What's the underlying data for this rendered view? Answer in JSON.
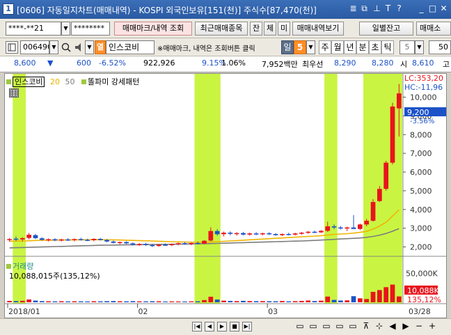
{
  "window": {
    "number": "1",
    "title": "[0606] 자동일지차트(매매내역) - KOSPI 외국인보유[151(천)] 주식수[87,470(천)] ",
    "icons": [
      "window-list-icon",
      "restore-icon",
      "help-pin-icon",
      "text-size-icon",
      "question-icon",
      "minimize-icon",
      "maximize-icon",
      "close-icon"
    ],
    "icon_glyphs": [
      "≣",
      "⧉",
      "⊥",
      "T",
      "?",
      "_",
      "□",
      "✕"
    ]
  },
  "toolbar1": {
    "account": "****-**21",
    "password": "********",
    "trade_mark_button": "매매마크/내역 조회",
    "recent_trades_button": "최근매매종목",
    "jan": "잔",
    "che": "체",
    "mi": "미",
    "trade_history_button": "매매내역보기",
    "daily_balance_button": "일별잔고",
    "trade_more_button": "매매소"
  },
  "toolbar2": {
    "code": "006490",
    "market_tag": "열",
    "stock_name": "인스코비",
    "notice": "※매매마크, 내역은 조회버튼 클릭",
    "period_label": "일",
    "period_value": "5",
    "periods": [
      "주",
      "월",
      "년",
      "분",
      "초",
      "틱"
    ],
    "tick_value": "5",
    "right_value": "50"
  },
  "quote": {
    "price": "8,600",
    "arrow": "▼",
    "change": "600",
    "change_pct": "-6.52%",
    "volume": "922,926",
    "vol_ratio": "9.15%",
    "turnover": "1.06%",
    "amount": "7,952백만",
    "best_label": "최우선",
    "best_ask": "8,290",
    "best_bid": "8,280",
    "open_label": "시",
    "open": "8,610",
    "high_label": "고"
  },
  "chart": {
    "legend_name": "인스코비",
    "ma_short": "20",
    "ma_long": "50",
    "pattern_label": "똘파미 강세패턴",
    "lc_label": "LC:353,20",
    "hc_label": "HC:-11,96",
    "price_badge": "9,200",
    "price_badge_pct": "-3.56%",
    "price_ticks": [
      "10,000",
      "9,000",
      "8,000",
      "7,000",
      "6,000",
      "5,000",
      "4,000",
      "3,000",
      "2,000"
    ],
    "volume_title": "거래량",
    "volume_value": "10,088,015주(135,12%)",
    "volume_tick": "50,000K",
    "volume_badge": "10,088K",
    "volume_badge_pct": "135,12%",
    "x_labels": [
      "2018/01",
      "02",
      "03"
    ],
    "x_right_label": "03/28",
    "colors": {
      "up": "#e8141c",
      "down": "#1c52c8",
      "highlight": "#c9f542",
      "ma20": "#f0b400",
      "ma50": "#7d7d7d"
    }
  },
  "chart_data": {
    "type": "candlestick",
    "ylim": [
      1500,
      10800
    ],
    "volume_ylim": [
      0,
      60000
    ],
    "highlight_ranges": [
      [
        1,
        2
      ],
      [
        29,
        32
      ],
      [
        49,
        50
      ],
      [
        55,
        60
      ]
    ],
    "candles": [
      {
        "o": 2380,
        "h": 2480,
        "l": 2280,
        "c": 2420,
        "v": 2400
      },
      {
        "o": 2440,
        "h": 2560,
        "l": 2320,
        "c": 2400,
        "v": 2100
      },
      {
        "o": 2400,
        "h": 2520,
        "l": 2300,
        "c": 2470,
        "v": 2600
      },
      {
        "o": 2480,
        "h": 2750,
        "l": 2400,
        "c": 2650,
        "v": 4800
      },
      {
        "o": 2630,
        "h": 2700,
        "l": 2420,
        "c": 2470,
        "v": 2900
      },
      {
        "o": 2460,
        "h": 2520,
        "l": 2330,
        "c": 2380,
        "v": 2000
      },
      {
        "o": 2380,
        "h": 2460,
        "l": 2290,
        "c": 2410,
        "v": 1700
      },
      {
        "o": 2410,
        "h": 2470,
        "l": 2310,
        "c": 2350,
        "v": 1500
      },
      {
        "o": 2340,
        "h": 2440,
        "l": 2290,
        "c": 2400,
        "v": 1800
      },
      {
        "o": 2400,
        "h": 2470,
        "l": 2320,
        "c": 2370,
        "v": 1500
      },
      {
        "o": 2370,
        "h": 2450,
        "l": 2300,
        "c": 2420,
        "v": 1700
      },
      {
        "o": 2420,
        "h": 2490,
        "l": 2340,
        "c": 2380,
        "v": 1600
      },
      {
        "o": 2380,
        "h": 2440,
        "l": 2310,
        "c": 2360,
        "v": 1400
      },
      {
        "o": 2360,
        "h": 2460,
        "l": 2300,
        "c": 2430,
        "v": 1800
      },
      {
        "o": 2430,
        "h": 2480,
        "l": 2340,
        "c": 2370,
        "v": 1600
      },
      {
        "o": 2370,
        "h": 2420,
        "l": 2250,
        "c": 2290,
        "v": 1900
      },
      {
        "o": 2290,
        "h": 2340,
        "l": 2180,
        "c": 2220,
        "v": 2100
      },
      {
        "o": 2220,
        "h": 2290,
        "l": 2140,
        "c": 2260,
        "v": 1700
      },
      {
        "o": 2260,
        "h": 2310,
        "l": 2150,
        "c": 2190,
        "v": 1600
      },
      {
        "o": 2190,
        "h": 2240,
        "l": 2080,
        "c": 2120,
        "v": 1900
      },
      {
        "o": 2120,
        "h": 2200,
        "l": 2050,
        "c": 2160,
        "v": 1600
      },
      {
        "o": 2160,
        "h": 2220,
        "l": 2060,
        "c": 2100,
        "v": 1500
      },
      {
        "o": 2100,
        "h": 2160,
        "l": 2000,
        "c": 2050,
        "v": 1800
      },
      {
        "o": 2050,
        "h": 2150,
        "l": 2010,
        "c": 2120,
        "v": 1700
      },
      {
        "o": 2120,
        "h": 2190,
        "l": 2060,
        "c": 2100,
        "v": 1300
      },
      {
        "o": 2100,
        "h": 2180,
        "l": 2040,
        "c": 2150,
        "v": 1500
      },
      {
        "o": 2150,
        "h": 2230,
        "l": 2080,
        "c": 2200,
        "v": 1400
      },
      {
        "o": 2200,
        "h": 2260,
        "l": 2120,
        "c": 2160,
        "v": 1300
      },
      {
        "o": 2160,
        "h": 2230,
        "l": 2090,
        "c": 2210,
        "v": 1600
      },
      {
        "o": 2210,
        "h": 2290,
        "l": 2140,
        "c": 2180,
        "v": 1700
      },
      {
        "o": 2180,
        "h": 2360,
        "l": 2150,
        "c": 2330,
        "v": 3800
      },
      {
        "o": 2340,
        "h": 3050,
        "l": 2300,
        "c": 2850,
        "v": 9500
      },
      {
        "o": 2850,
        "h": 2950,
        "l": 2600,
        "c": 2680,
        "v": 4700
      },
      {
        "o": 2680,
        "h": 2820,
        "l": 2560,
        "c": 2760,
        "v": 2800
      },
      {
        "o": 2760,
        "h": 2830,
        "l": 2620,
        "c": 2700,
        "v": 2300
      },
      {
        "o": 2700,
        "h": 2790,
        "l": 2600,
        "c": 2740,
        "v": 2000
      },
      {
        "o": 2740,
        "h": 2800,
        "l": 2620,
        "c": 2660,
        "v": 2500
      },
      {
        "o": 2660,
        "h": 2770,
        "l": 2600,
        "c": 2720,
        "v": 2100
      },
      {
        "o": 2720,
        "h": 2790,
        "l": 2630,
        "c": 2680,
        "v": 1900
      },
      {
        "o": 2680,
        "h": 2760,
        "l": 2620,
        "c": 2730,
        "v": 2000
      },
      {
        "o": 2730,
        "h": 2790,
        "l": 2640,
        "c": 2690,
        "v": 1800
      },
      {
        "o": 2690,
        "h": 2740,
        "l": 2600,
        "c": 2630,
        "v": 1700
      },
      {
        "o": 2630,
        "h": 2720,
        "l": 2580,
        "c": 2690,
        "v": 2200
      },
      {
        "o": 2690,
        "h": 2760,
        "l": 2620,
        "c": 2660,
        "v": 1600
      },
      {
        "o": 2660,
        "h": 2760,
        "l": 2610,
        "c": 2720,
        "v": 1900
      },
      {
        "o": 2720,
        "h": 2800,
        "l": 2650,
        "c": 2760,
        "v": 2300
      },
      {
        "o": 2760,
        "h": 2850,
        "l": 2700,
        "c": 2810,
        "v": 3100
      },
      {
        "o": 2810,
        "h": 2880,
        "l": 2740,
        "c": 2780,
        "v": 2100
      },
      {
        "o": 2780,
        "h": 2900,
        "l": 2740,
        "c": 2860,
        "v": 2800
      },
      {
        "o": 2860,
        "h": 3350,
        "l": 2800,
        "c": 3100,
        "v": 9800
      },
      {
        "o": 3100,
        "h": 3200,
        "l": 2950,
        "c": 3040,
        "v": 4100
      },
      {
        "o": 3040,
        "h": 3120,
        "l": 2930,
        "c": 2990,
        "v": 3000
      },
      {
        "o": 2990,
        "h": 3080,
        "l": 2850,
        "c": 3040,
        "v": 3300
      },
      {
        "o": 3040,
        "h": 3700,
        "l": 2980,
        "c": 2960,
        "v": 10500
      },
      {
        "o": 2960,
        "h": 3250,
        "l": 2900,
        "c": 3200,
        "v": 6800
      },
      {
        "o": 3200,
        "h": 3500,
        "l": 3100,
        "c": 3400,
        "v": 5600
      },
      {
        "o": 3400,
        "h": 4550,
        "l": 3350,
        "c": 4400,
        "v": 18000
      },
      {
        "o": 4450,
        "h": 5250,
        "l": 4400,
        "c": 5100,
        "v": 21000
      },
      {
        "o": 5100,
        "h": 6600,
        "l": 5000,
        "c": 6500,
        "v": 26000
      },
      {
        "o": 6500,
        "h": 9700,
        "l": 6400,
        "c": 9500,
        "v": 30500
      },
      {
        "o": 9400,
        "h": 10700,
        "l": 7900,
        "c": 10200,
        "v": 10100
      }
    ],
    "ma20": [
      2300,
      2310,
      2320,
      2330,
      2345,
      2355,
      2360,
      2365,
      2370,
      2375,
      2378,
      2380,
      2382,
      2384,
      2385,
      2383,
      2378,
      2370,
      2360,
      2350,
      2340,
      2330,
      2318,
      2305,
      2292,
      2280,
      2270,
      2262,
      2255,
      2250,
      2250,
      2265,
      2280,
      2300,
      2320,
      2340,
      2360,
      2380,
      2400,
      2420,
      2440,
      2460,
      2480,
      2500,
      2520,
      2540,
      2560,
      2580,
      2600,
      2640,
      2670,
      2690,
      2710,
      2740,
      2780,
      2830,
      2950,
      3120,
      3320,
      3650,
      3980
    ],
    "ma50": [
      1950,
      1960,
      1970,
      1980,
      1990,
      2000,
      2010,
      2020,
      2030,
      2040,
      2050,
      2060,
      2070,
      2080,
      2090,
      2095,
      2100,
      2105,
      2110,
      2115,
      2120,
      2125,
      2130,
      2135,
      2140,
      2145,
      2150,
      2155,
      2160,
      2165,
      2170,
      2180,
      2190,
      2200,
      2210,
      2220,
      2230,
      2240,
      2250,
      2260,
      2270,
      2280,
      2290,
      2300,
      2310,
      2320,
      2335,
      2350,
      2365,
      2385,
      2405,
      2425,
      2440,
      2460,
      2480,
      2510,
      2560,
      2630,
      2720,
      2840,
      2980
    ]
  }
}
